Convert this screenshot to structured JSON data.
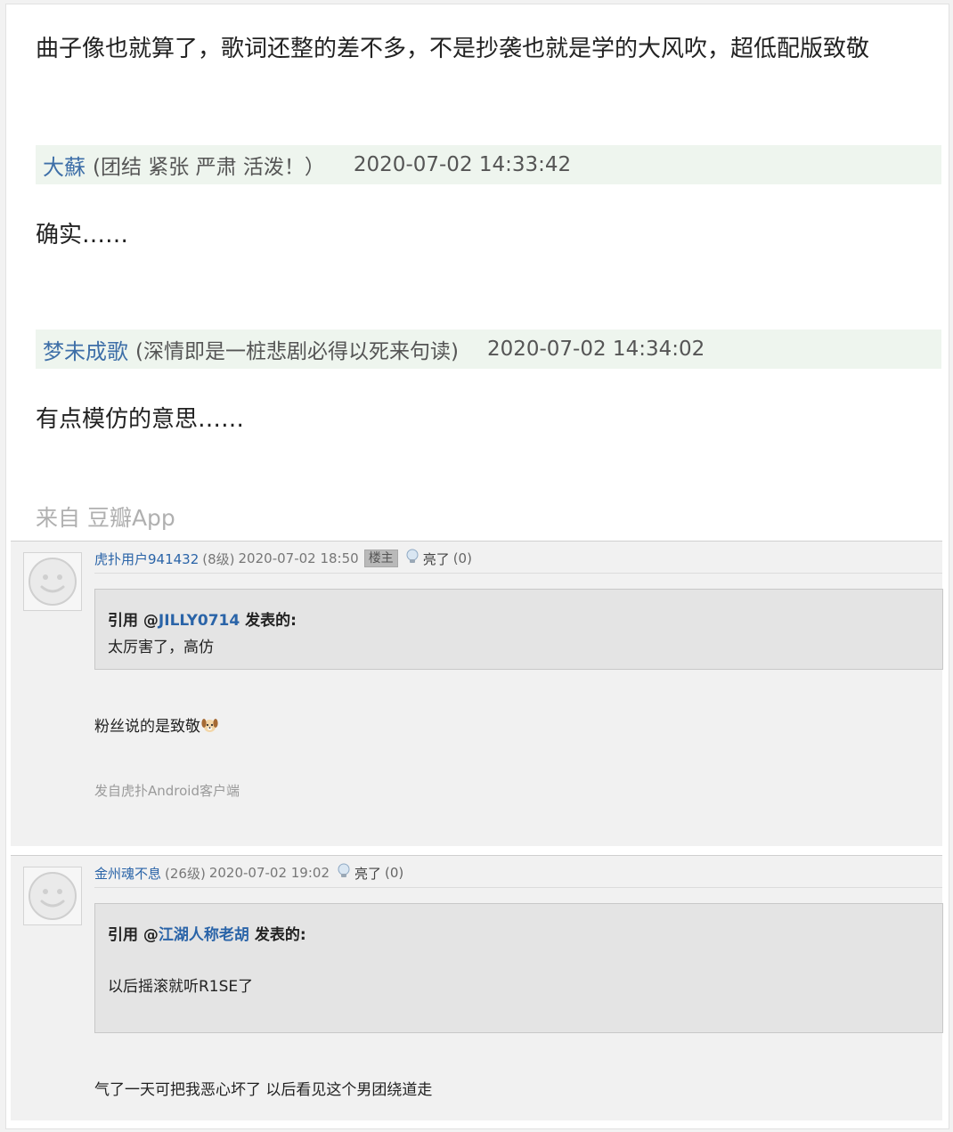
{
  "douban": {
    "intro_text": "曲子像也就算了，歌词还整的差不多，不是抄袭也就是学的大风吹，超低配版致敬",
    "comments": [
      {
        "username": "大蘇",
        "signature": "(团结 紧张 严肃 活泼！）",
        "timestamp": "2020-07-02 14:33:42",
        "text": "确实……"
      },
      {
        "username": "梦未成歌",
        "signature": "(深情即是一桩悲剧必得以死来句读)",
        "timestamp": "2020-07-02 14:34:02",
        "text": "有点模仿的意思……"
      }
    ],
    "source": "来自 豆瓣App"
  },
  "hupu": {
    "posts": [
      {
        "username": "虎扑用户941432",
        "level": "(8级)",
        "timestamp": "2020-07-02 18:50",
        "badge": "楼主",
        "light_label": "亮了",
        "light_count": "(0)",
        "quote_prefix": "引用 @",
        "quote_user": "JILLY0714",
        "quote_suffix": " 发表的:",
        "quote_text": "太厉害了，高仿",
        "text": "粉丝说的是致敬",
        "emoji": "dog-face-emoji",
        "client": "发自虎扑Android客户端"
      },
      {
        "username": "金州魂不息",
        "level": "(26级)",
        "timestamp": "2020-07-02 19:02",
        "light_label": "亮了",
        "light_count": "(0)",
        "quote_prefix": "引用 @",
        "quote_user": "江湖人称老胡",
        "quote_suffix": " 发表的:",
        "quote_text": "以后摇滚就听R1SE了",
        "text": "气了一天可把我恶心坏了 以后看见这个男团绕道走"
      }
    ]
  },
  "colors": {
    "link_blue": "#2a64a8",
    "douban_name_blue": "#3e6fa8",
    "douban_header_bg": "#eef5ee",
    "hupu_bg": "#f1f1f1",
    "quote_bg": "#e4e4e4"
  }
}
